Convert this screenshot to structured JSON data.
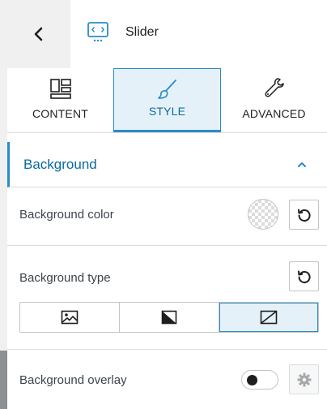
{
  "header": {
    "back_icon": "chevron-left-icon",
    "widget_icon": "slider-widget-icon",
    "title": "Slider"
  },
  "tabs": [
    {
      "label": "CONTENT",
      "icon": "layout-icon",
      "active": false
    },
    {
      "label": "STYLE",
      "icon": "brush-icon",
      "active": true
    },
    {
      "label": "ADVANCED",
      "icon": "wrench-icon",
      "active": false
    }
  ],
  "section": {
    "title": "Background",
    "expanded": true,
    "icon": "chevron-up-icon"
  },
  "fields": {
    "bg_color_label": "Background color",
    "bg_type_label": "Background type",
    "bg_overlay_label": "Background overlay",
    "reset_icon": "reset-icon",
    "settings_icon": "gear-icon"
  },
  "bg_types": [
    {
      "icon": "image-icon",
      "active": false
    },
    {
      "icon": "gradient-icon",
      "active": false
    },
    {
      "icon": "no-background-icon",
      "active": true
    }
  ],
  "overlay_enabled": false,
  "colors": {
    "accent": "#2a8bc9",
    "accent_text": "#0a6aa1",
    "active_bg": "#e5f1f8"
  }
}
